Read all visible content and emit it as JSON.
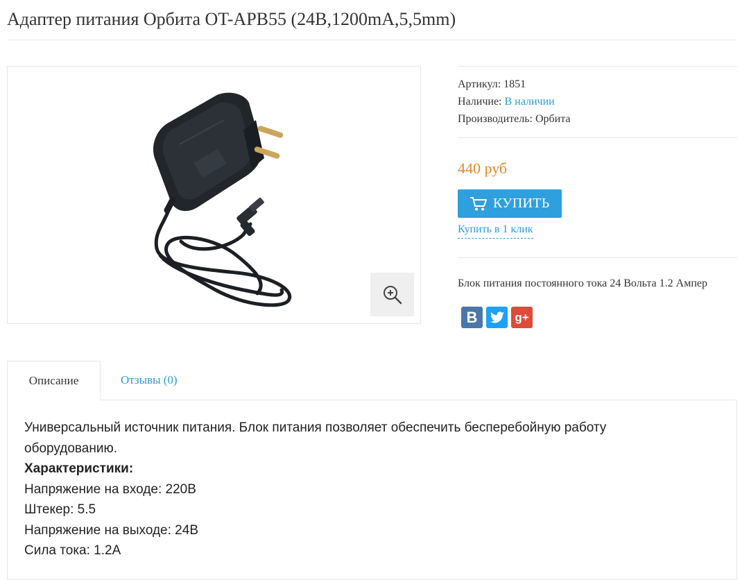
{
  "product": {
    "title": "Адаптер питания Орбита OT-APB55 (24В,1200mA,5,5mm)",
    "sku_label": "Артикул:",
    "sku_value": "1851",
    "availability_label": "Наличие:",
    "availability_value": "В наличии",
    "manufacturer_label": "Производитель:",
    "manufacturer_value": "Орбита",
    "price": "440 руб",
    "buy_label": "Купить",
    "one_click_label": "Купить в 1 клик",
    "short_description": "Блок питания постоянного тока 24 Вольта 1.2 Ампер"
  },
  "social": {
    "vk": "В",
    "google_plus": "g+"
  },
  "tabs": [
    {
      "label": "Описание",
      "active": true
    },
    {
      "label": "Отзывы (0)",
      "active": false
    }
  ],
  "description": {
    "intro": "Универсальный источник питания. Блок питания позволяет обеспечить бесперебойную работу оборудованию.",
    "specs_heading": "Характеристики:",
    "specs": [
      "Напряжение на входе: 220В",
      "Штекер: 5.5",
      "Напряжение на выходе: 24В",
      "Сила тока: 1.2А"
    ]
  },
  "colors": {
    "link": "#2b9ad6",
    "price": "#e88a26",
    "buy_button": "#2fa0dd",
    "vk": "#4a76a8",
    "twitter": "#1da1f2",
    "google_plus": "#dd4b39"
  },
  "icons": {
    "zoom": "zoom-in-icon",
    "cart": "cart-icon"
  }
}
